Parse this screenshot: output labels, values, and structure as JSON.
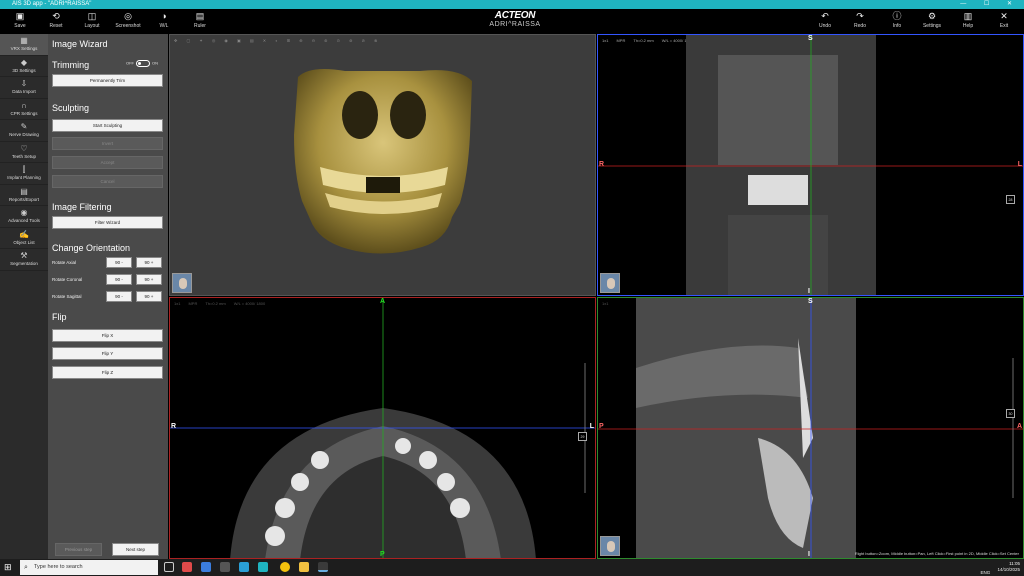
{
  "window": {
    "title": "AIS 3D app - \"ADRI^RAISSA\""
  },
  "toolbar_left": [
    {
      "label": "Save",
      "icon": "save-icon",
      "glyph": "▣"
    },
    {
      "label": "Reset",
      "icon": "reset-icon",
      "glyph": "⟲"
    },
    {
      "label": "Layout",
      "icon": "layout-icon",
      "glyph": "◫"
    },
    {
      "label": "Screenshot",
      "icon": "camera-icon",
      "glyph": "◎"
    },
    {
      "label": "W/L",
      "icon": "contrast-icon",
      "glyph": "◑"
    },
    {
      "label": "Ruler",
      "icon": "ruler-icon",
      "glyph": "▤"
    }
  ],
  "toolbar_right": [
    {
      "label": "Undo",
      "icon": "undo-icon",
      "glyph": "↶"
    },
    {
      "label": "Redo",
      "icon": "redo-icon",
      "glyph": "↷"
    },
    {
      "label": "Info",
      "icon": "info-icon",
      "glyph": "ⓘ"
    },
    {
      "label": "Settings",
      "icon": "gear-icon",
      "glyph": "⚙"
    },
    {
      "label": "Help",
      "icon": "book-icon",
      "glyph": "▥"
    },
    {
      "label": "Exit",
      "icon": "close-icon",
      "glyph": "✕"
    }
  ],
  "brand": {
    "logo": "ACTEON",
    "patient": "ADRI^RAISSA"
  },
  "sidebar": [
    {
      "label": "VRX Settings",
      "icon": "vrx-settings-icon",
      "glyph": "▦",
      "active": true
    },
    {
      "label": "3D Settings",
      "icon": "3d-settings-icon",
      "glyph": "◆"
    },
    {
      "label": "Data Import",
      "icon": "data-import-icon",
      "glyph": "⇩"
    },
    {
      "label": "CPR Settings",
      "icon": "cpr-settings-icon",
      "glyph": "∩"
    },
    {
      "label": "Nerve Drawing",
      "icon": "nerve-drawing-icon",
      "glyph": "✎"
    },
    {
      "label": "Teeth Setup",
      "icon": "tooth-icon",
      "glyph": "♡"
    },
    {
      "label": "Implant Planning",
      "icon": "implant-icon",
      "glyph": "⫿"
    },
    {
      "label": "Reports/Export",
      "icon": "reports-icon",
      "glyph": "▤"
    },
    {
      "label": "Advanced Tools",
      "icon": "advanced-tools-icon",
      "glyph": "◉"
    },
    {
      "label": "Object List",
      "icon": "object-list-icon",
      "glyph": "✍"
    },
    {
      "label": "Segmentation",
      "icon": "segmentation-icon",
      "glyph": "⚒"
    }
  ],
  "wizard": {
    "title": "Image Wizard",
    "trimming": {
      "heading": "Trimming",
      "off": "OFF",
      "on": "ON",
      "permanent_trim": "Permanently Trim"
    },
    "sculpting": {
      "heading": "Sculpting",
      "start": "Start Sculpting",
      "invert": "Invert",
      "accept": "Accept",
      "cancel": "Cancel"
    },
    "filtering": {
      "heading": "Image Filtering",
      "filter_wizard": "Filter Wizard"
    },
    "orientation": {
      "heading": "Change Orientation",
      "rows": [
        {
          "label": "Rotate Axial",
          "minus": "90 -",
          "plus": "90 +"
        },
        {
          "label": "Rotate Coronal",
          "minus": "90 -",
          "plus": "90 +"
        },
        {
          "label": "Rotate Sagittal",
          "minus": "90 -",
          "plus": "90 +"
        }
      ]
    },
    "flip": {
      "heading": "Flip",
      "x": "Flip X",
      "y": "Flip Y",
      "z": "Flip Z"
    },
    "previous": "Previous step",
    "next": "Next step"
  },
  "views": {
    "coronal": {
      "mode": "1x1",
      "type": "MPR",
      "thickness": "Th=0.2 mm",
      "wl": "W/L = 4000/ 1800",
      "top": "S",
      "bottom": "I",
      "left": "R",
      "right": "L",
      "slider": "28"
    },
    "axial": {
      "mode": "1x1",
      "type": "MPR",
      "thickness": "Th=0.2 mm",
      "wl": "W/L = 4000/ 1800",
      "top": "A",
      "bottom": "P",
      "left": "R",
      "right": "L",
      "slider": "29"
    },
    "sagittal": {
      "mode": "1x1",
      "top": "S",
      "bottom": "I",
      "left": "P",
      "right": "A",
      "slider": "30",
      "hint": "Right button=Zoom, Middle button=Pan, Left Click=First point in 2D, Middle Click=Set Center"
    }
  },
  "taskbar": {
    "search": "Type here to search",
    "lang": "ENG",
    "time": "11:05",
    "date": "14/10/2025"
  },
  "colors": {
    "accent": "#1fb4c0",
    "coronal_border": "#3355ff",
    "axial_border": "#aa2222",
    "sagittal_border": "#2e8a2e"
  }
}
